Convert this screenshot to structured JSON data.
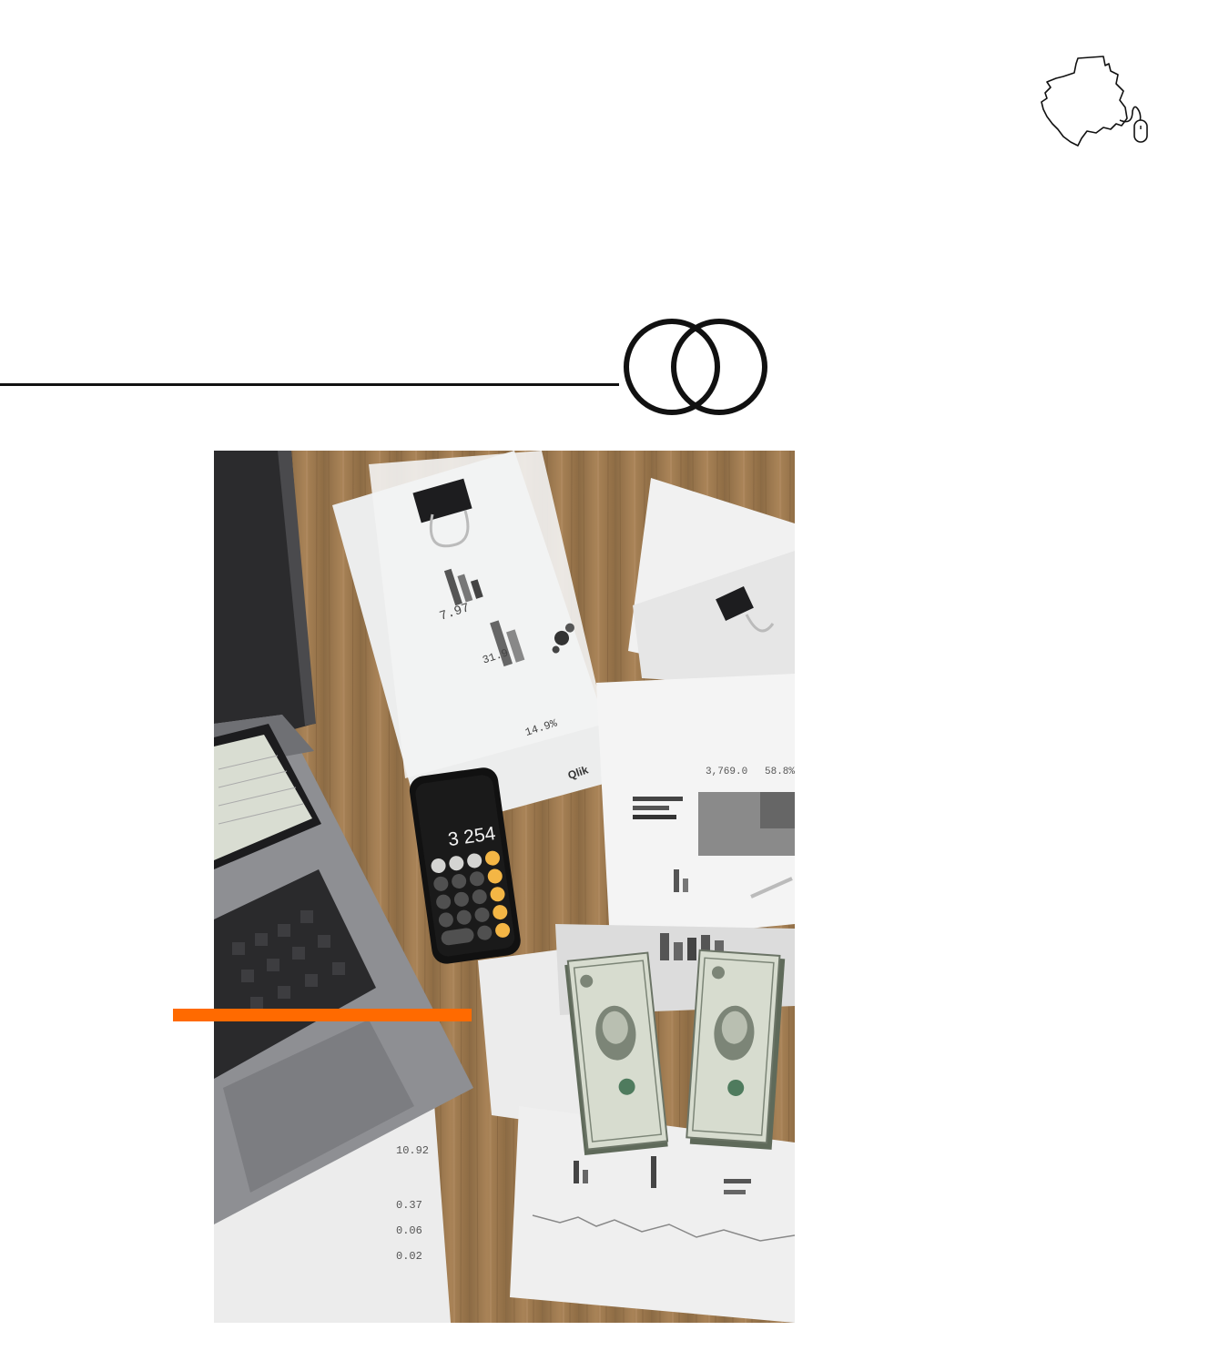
{
  "colors": {
    "background": "#ffffff",
    "line": "#111111",
    "accent": "#ff6a00",
    "desk": "#9c7a52"
  },
  "logo": {
    "icon": "gabon-map-mouse-icon"
  },
  "decor": {
    "rings_icon": "interlocking-rings-icon"
  },
  "photo": {
    "subject": "finance-desk-photo",
    "calculator_display": "3 254",
    "qlik_label": "Qlik",
    "doc_value_1": "3,769.0",
    "doc_value_2": "58.8%",
    "doc_value_3": "10.92",
    "doc_value_4": "0.37",
    "doc_value_5": "0.06",
    "doc_value_6": "0.02",
    "doc_value_7": "7.97",
    "doc_value_8": "31.9",
    "doc_value_9": "14.9%"
  }
}
